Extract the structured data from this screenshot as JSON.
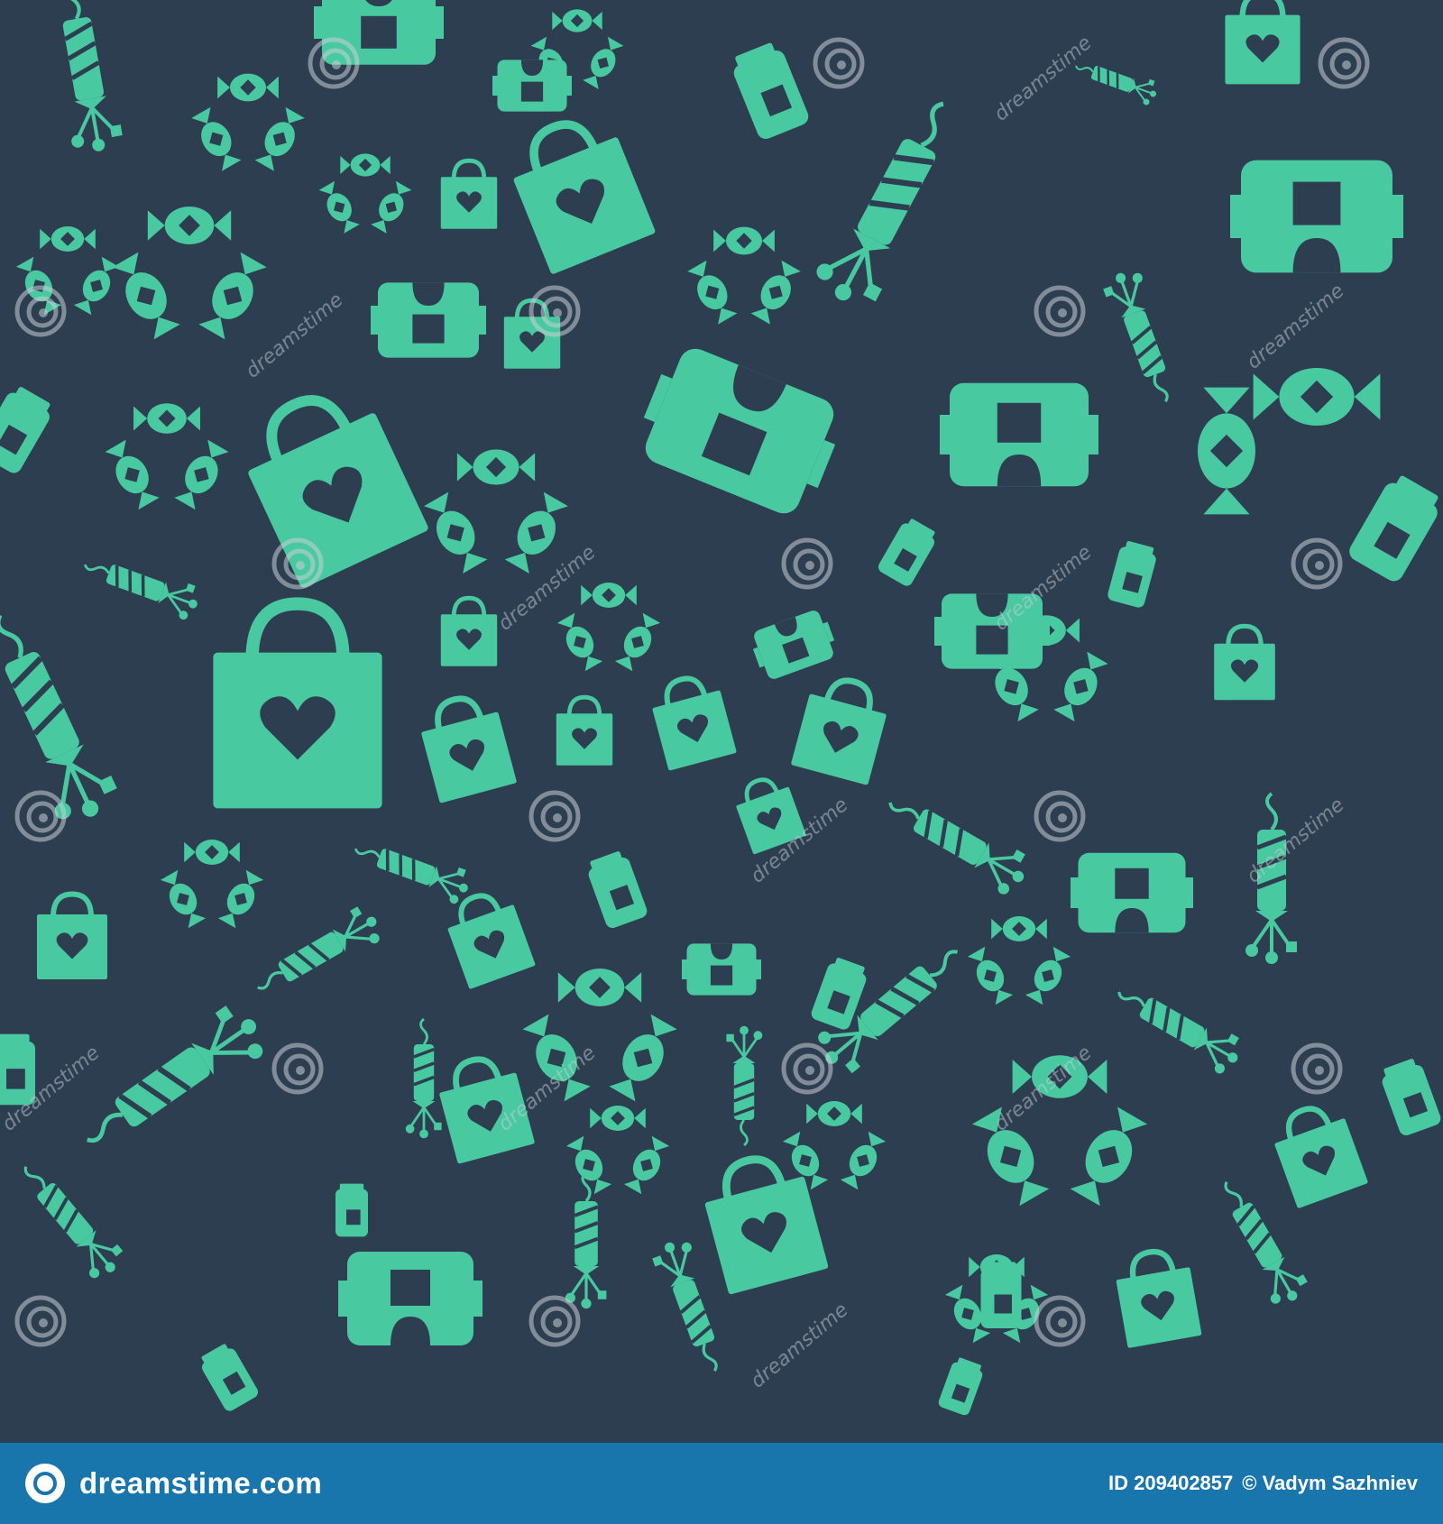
{
  "image": {
    "description_icons": [
      "shopping-bag-heart-icon",
      "candy-icon",
      "firework-rocket-icon",
      "camera-icon",
      "soda-can-icon"
    ],
    "colors": {
      "background": "#2d3e50",
      "icon": "#48c9a0",
      "footer": "#1976ad",
      "watermark": "#c9ced6"
    },
    "watermark_text": "dreamstime"
  },
  "footer": {
    "brand": "dreamstime.com",
    "id_label": "ID 209402857",
    "copyright": "© Vadym Sazhniev"
  }
}
